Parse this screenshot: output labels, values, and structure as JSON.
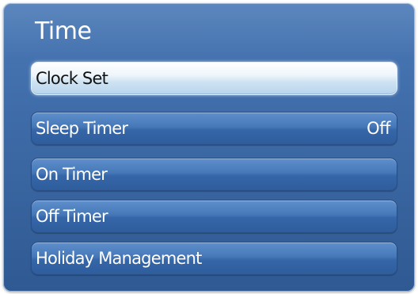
{
  "menu": {
    "title": "Time",
    "items": [
      {
        "label": "Clock Set",
        "value": "",
        "selected": true
      },
      {
        "label": "Sleep Timer",
        "value": "Off",
        "selected": false
      },
      {
        "label": "On Timer",
        "value": "",
        "selected": false
      },
      {
        "label": "Off Timer",
        "value": "",
        "selected": false
      },
      {
        "label": "Holiday Management",
        "value": "",
        "selected": false
      }
    ]
  },
  "colors": {
    "panel": "#3d6aa6",
    "item": "#4678b8",
    "selected_item": "#cfe3f2",
    "text": "#ffffff",
    "selected_text": "#111111"
  }
}
